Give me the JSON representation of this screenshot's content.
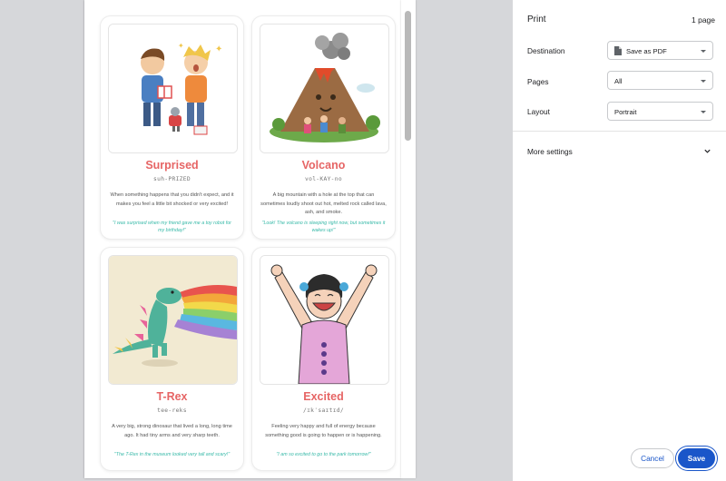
{
  "cards": [
    {
      "word": "Surprised",
      "pronunciation": "suh-PRIZED",
      "definition": "When something happens that you didn't expect, and it makes you feel a little bit shocked or very excited!",
      "example": "\"I was surprised when my friend gave me a toy robot for my birthday!\"",
      "illustration": "two-boys-gift-robot-image"
    },
    {
      "word": "Volcano",
      "pronunciation": "vol-KAY-no",
      "definition": "A big mountain with a hole at the top that can sometimes loudly shoot out hot, melted rock called lava, ash, and smoke.",
      "example": "\"Look! The volcano is sleeping right now, but sometimes it wakes up!\"",
      "illustration": "volcano-kids-image"
    },
    {
      "word": "T-Rex",
      "pronunciation": "tee-reks",
      "definition": "A very big, strong dinosaur that lived a long, long time ago. It had tiny arms and very sharp teeth.",
      "example": "\"The T-Rex in the museum looked very tall and scary!\"",
      "illustration": "dinosaur-rainbow-image"
    },
    {
      "word": "Excited",
      "pronunciation": "/ɪkˈsaɪtɪd/",
      "definition": "Feeling very happy and full of energy because something good is going to happen or is happening.",
      "example": "\"I am so excited to go to the park tomorrow!\"",
      "illustration": "cheering-girl-image"
    }
  ],
  "panel": {
    "title": "Print",
    "page_count": "1 page",
    "destination_label": "Destination",
    "destination_value": "Save as PDF",
    "pages_label": "Pages",
    "pages_value": "All",
    "layout_label": "Layout",
    "layout_value": "Portrait",
    "more_settings": "More settings",
    "cancel": "Cancel",
    "save": "Save"
  },
  "colors": {
    "accent": "#1a56c9",
    "word": "#e66565",
    "example": "#37b9a8"
  }
}
